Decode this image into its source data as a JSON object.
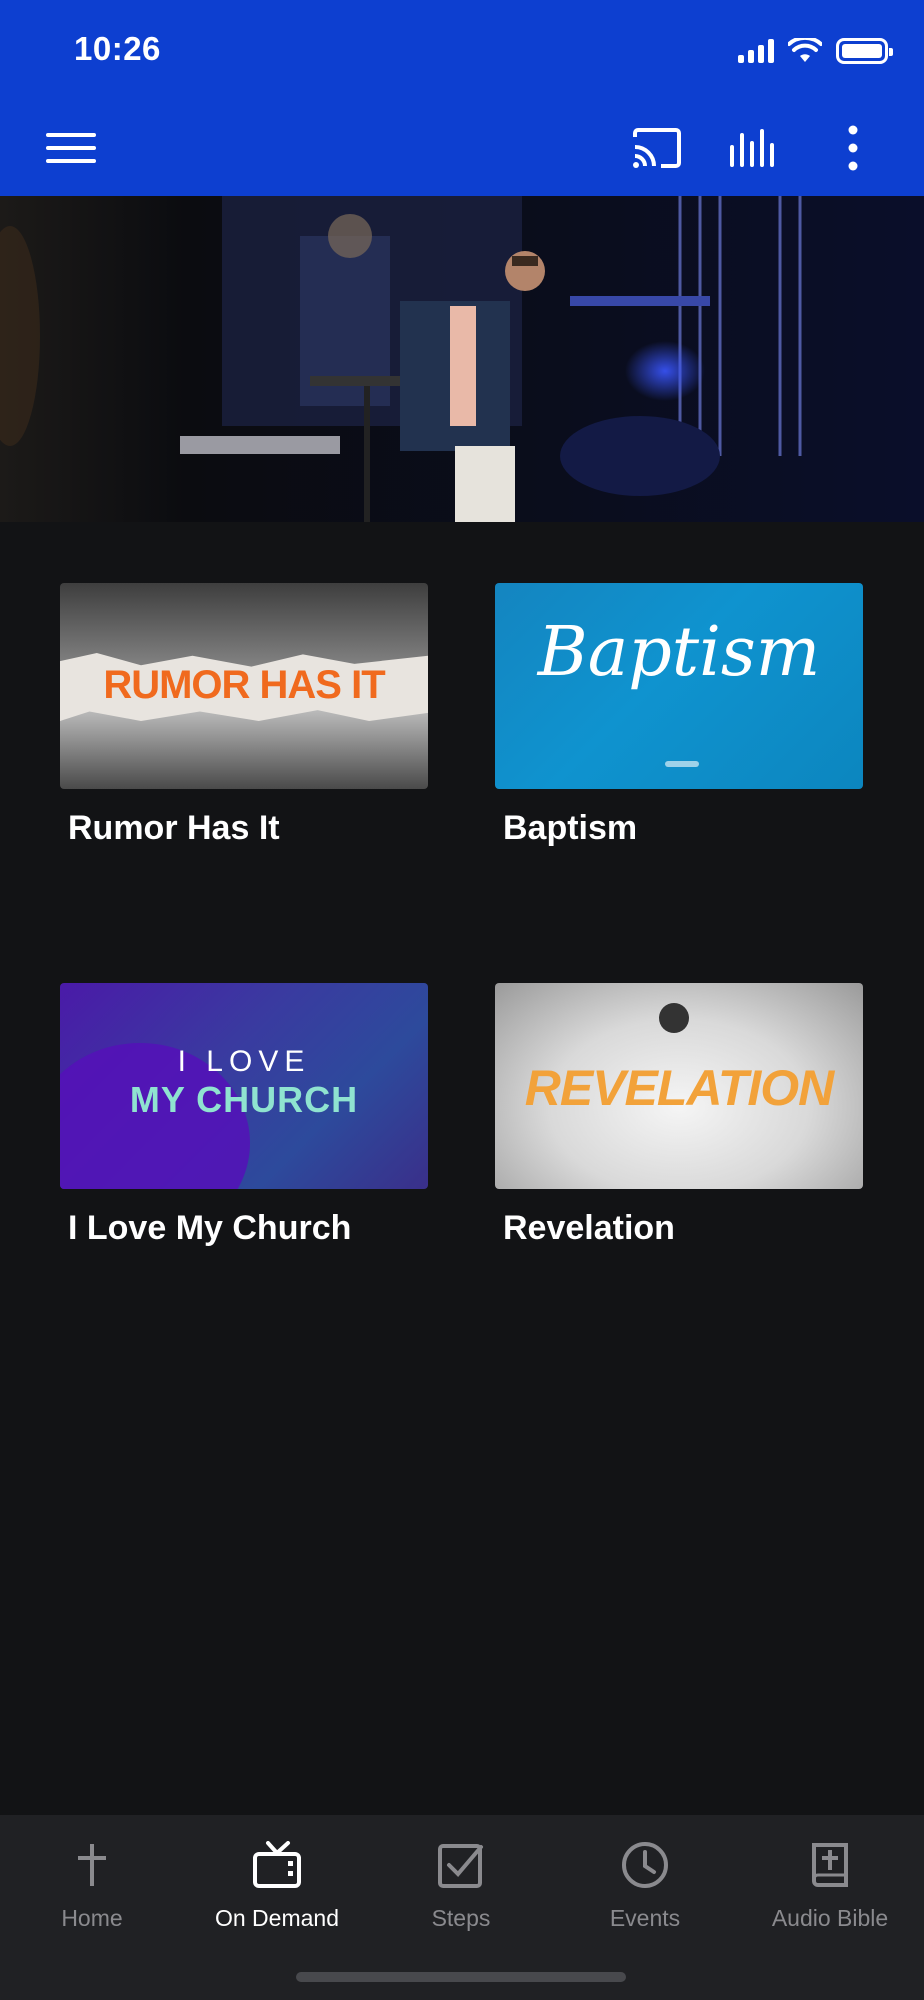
{
  "status_bar": {
    "time": "10:26"
  },
  "app_bar": {
    "menu_icon": "hamburger-menu-icon",
    "cast_icon": "cast-icon",
    "audio_icon": "audio-bars-icon",
    "more_icon": "more-vertical-icon",
    "accent_color": "#0d3fd0"
  },
  "hero": {
    "image": "pastor-speaking-on-stage"
  },
  "grid": {
    "items": [
      {
        "title": "Rumor Has It",
        "art_text": "RUMOR HAS IT"
      },
      {
        "title": "Baptism",
        "art_text": "Baptism"
      },
      {
        "title": "I Love My Church",
        "art_text_line1": "I LOVE",
        "art_text_line2": "MY CHURCH"
      },
      {
        "title": "Revelation",
        "art_text": "REVELATION"
      }
    ]
  },
  "tabbar": {
    "active": "On Demand",
    "tabs": [
      {
        "label": "Home",
        "icon": "cross-icon"
      },
      {
        "label": "On Demand",
        "icon": "tv-icon"
      },
      {
        "label": "Steps",
        "icon": "checkbox-icon"
      },
      {
        "label": "Events",
        "icon": "clock-icon"
      },
      {
        "label": "Audio Bible",
        "icon": "bible-icon"
      }
    ]
  }
}
